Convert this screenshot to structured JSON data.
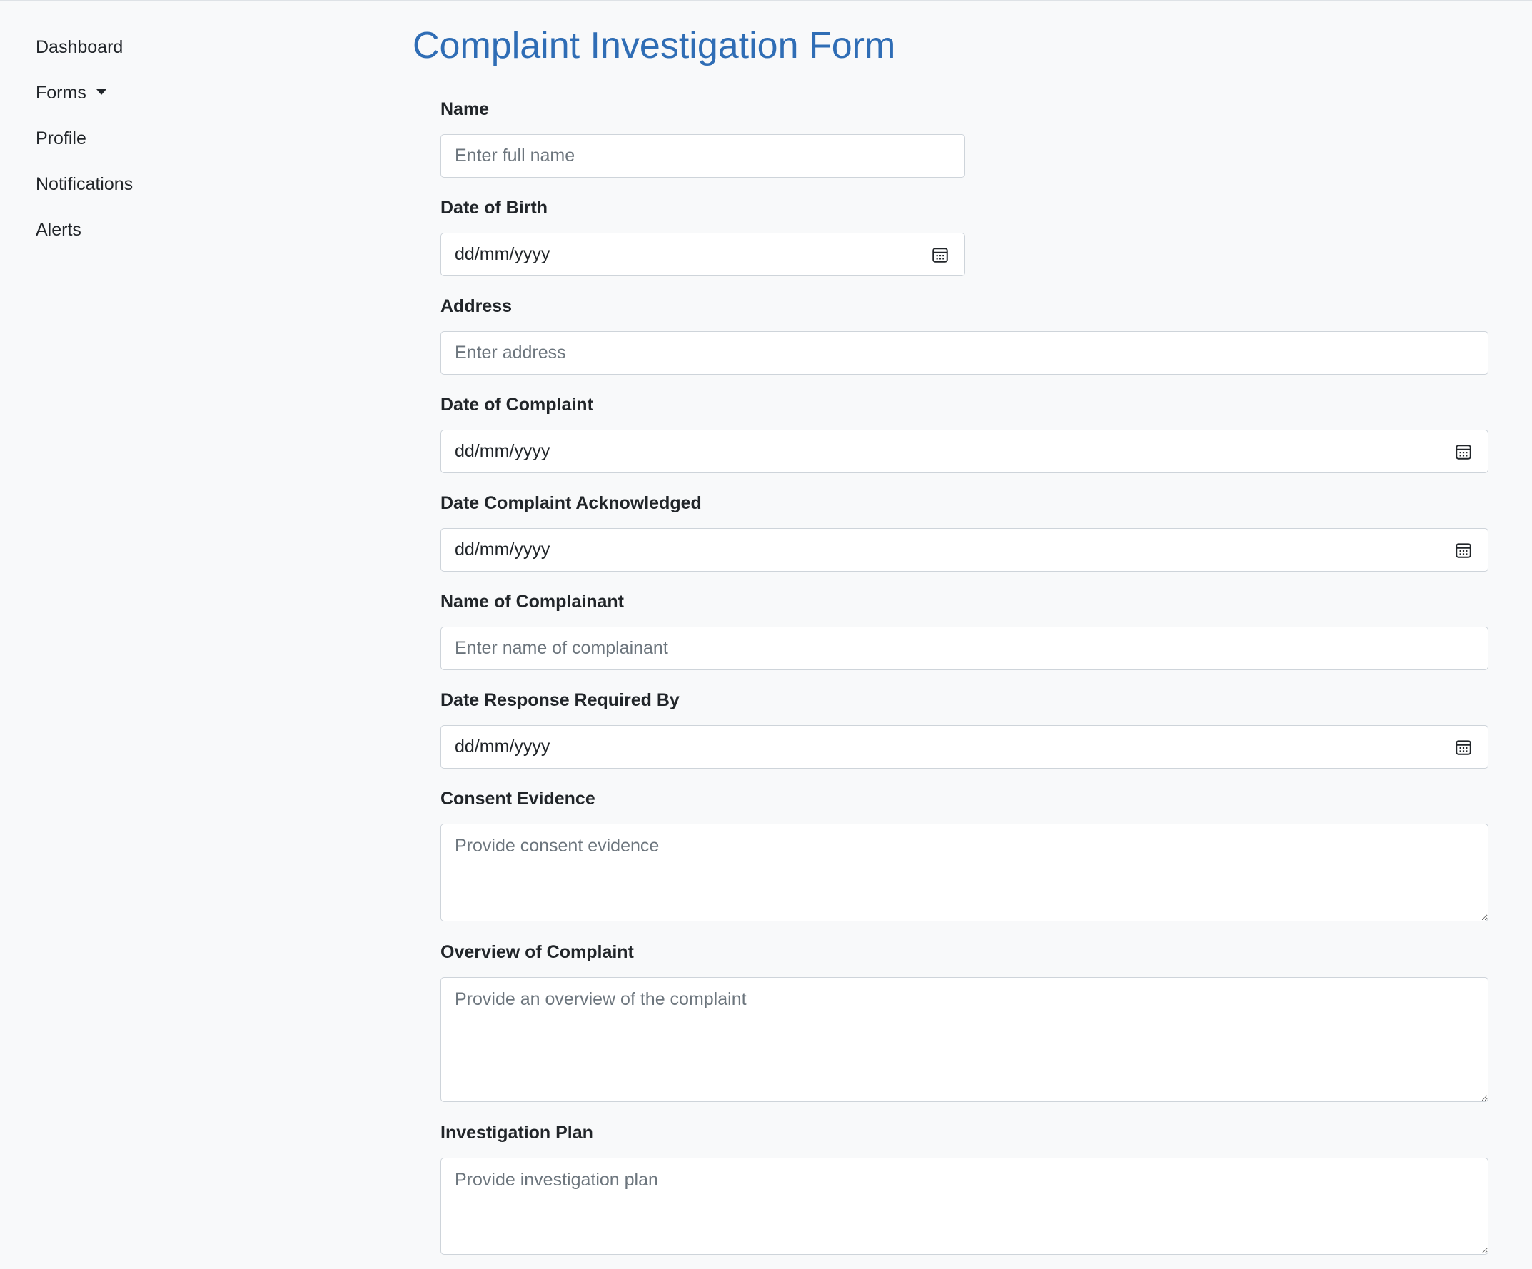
{
  "sidebar": {
    "items": [
      {
        "label": "Dashboard"
      },
      {
        "label": "Forms"
      },
      {
        "label": "Profile"
      },
      {
        "label": "Notifications"
      },
      {
        "label": "Alerts"
      }
    ]
  },
  "form": {
    "title": "Complaint Investigation Form",
    "name": {
      "label": "Name",
      "placeholder": "Enter full name"
    },
    "dob": {
      "label": "Date of Birth",
      "value": "dd/mm/yyyy"
    },
    "address": {
      "label": "Address",
      "placeholder": "Enter address"
    },
    "date_complaint": {
      "label": "Date of Complaint",
      "value": "dd/mm/yyyy"
    },
    "date_acknowledged": {
      "label": "Date Complaint Acknowledged",
      "value": "dd/mm/yyyy"
    },
    "complainant": {
      "label": "Name of Complainant",
      "placeholder": "Enter name of complainant"
    },
    "date_response": {
      "label": "Date Response Required By",
      "value": "dd/mm/yyyy"
    },
    "consent": {
      "label": "Consent Evidence",
      "placeholder": "Provide consent evidence"
    },
    "overview": {
      "label": "Overview of Complaint",
      "placeholder": "Provide an overview of the complaint"
    },
    "plan": {
      "label": "Investigation Plan",
      "placeholder": "Provide investigation plan"
    }
  },
  "colors": {
    "background": "#f8f9fa",
    "title": "#2f6db5",
    "border": "#ced4da",
    "placeholder": "#6c757d",
    "text": "#212529"
  },
  "icons": {
    "calendar": "calendar-icon",
    "dropdown": "caret-down-icon",
    "resize": "resize-handle-icon"
  }
}
